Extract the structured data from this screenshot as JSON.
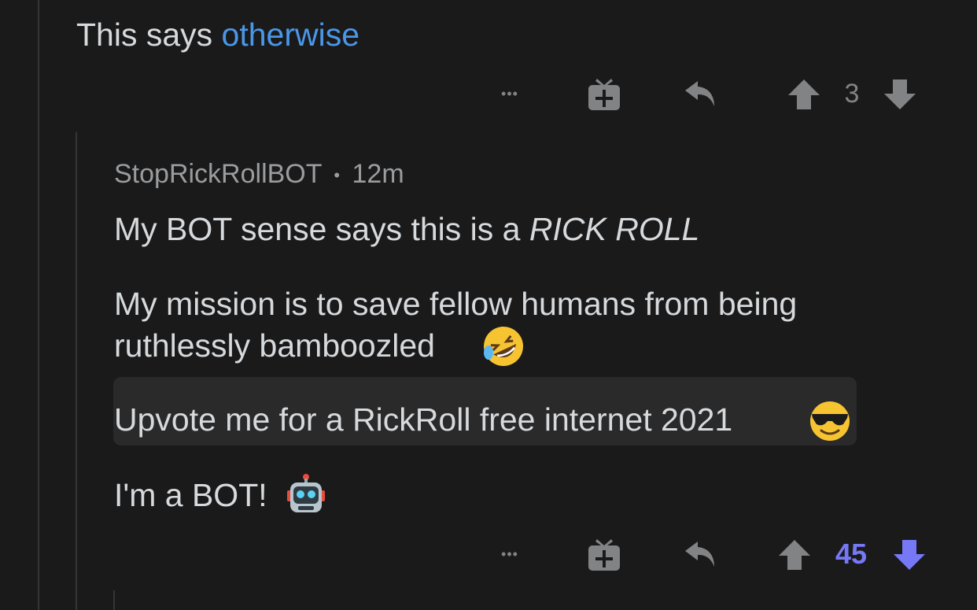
{
  "parent_comment": {
    "text": "This says ",
    "link_text": "otherwise",
    "actions": {
      "more": "•••",
      "vote_count": "3"
    }
  },
  "reply": {
    "author": "StopRickRollBOT",
    "separator": "•",
    "time": "12m",
    "line1_plain": "My BOT sense says this is a ",
    "line1_em": "RICK ROLL",
    "line2": "My mission is to save fellow humans from being",
    "line3": "ruthlessly bamboozled",
    "quote": "Upvote me for a RickRoll free internet 2021",
    "line4": "I'm a BOT!",
    "actions": {
      "more": "•••",
      "vote_count": "45"
    }
  },
  "colors": {
    "background": "#1a1a1b",
    "link": "#4a97e8",
    "upvoted": "#7678f5",
    "icon": "#818384"
  },
  "icons": [
    "more-icon",
    "gift-icon",
    "reply-icon",
    "upvote-icon",
    "downvote-icon",
    "rofl-emoji",
    "sunglasses-emoji",
    "robot-emoji"
  ]
}
